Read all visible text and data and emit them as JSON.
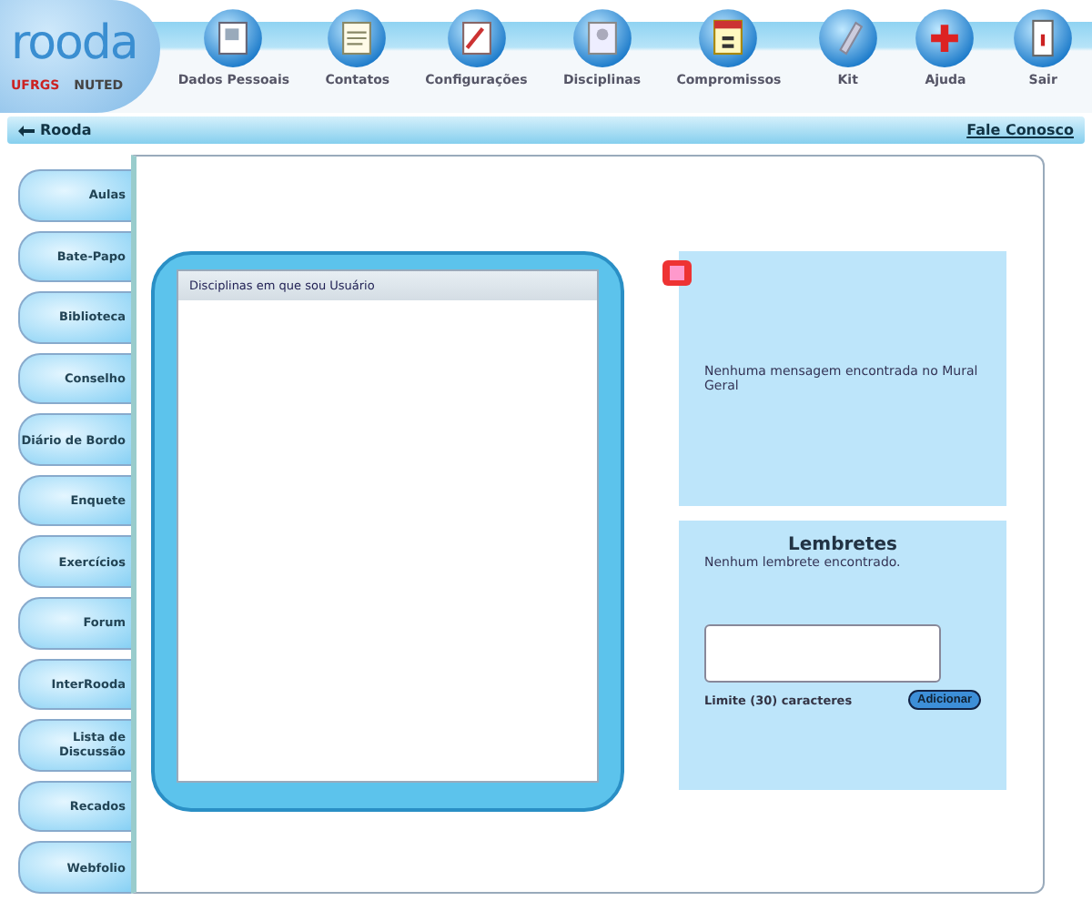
{
  "logo": {
    "title": "rooda",
    "partners": [
      "UFRGS",
      "NUTED"
    ]
  },
  "menu": [
    {
      "label": "Dados Pessoais"
    },
    {
      "label": "Contatos"
    },
    {
      "label": "Configurações"
    },
    {
      "label": "Disciplinas"
    },
    {
      "label": "Compromissos"
    },
    {
      "label": "Kit"
    },
    {
      "label": "Ajuda"
    },
    {
      "label": "Sair"
    }
  ],
  "breadcrumb": {
    "back": "Rooda",
    "contact": "Fale Conosco"
  },
  "sidebar": {
    "items": [
      {
        "label": "Aulas"
      },
      {
        "label": "Bate-Papo"
      },
      {
        "label": "Biblioteca"
      },
      {
        "label": "Conselho"
      },
      {
        "label": "Diário de Bordo"
      },
      {
        "label": "Enquete"
      },
      {
        "label": "Exercícios"
      },
      {
        "label": "Forum"
      },
      {
        "label": "InterRooda"
      },
      {
        "label": "Lista de Discussão"
      },
      {
        "label": "Recados"
      },
      {
        "label": "Webfolio"
      }
    ]
  },
  "disciplines": {
    "header": "Disciplinas em que sou Usuário"
  },
  "mural": {
    "message": "Nenhuma mensagem encontrada no Mural Geral"
  },
  "reminders": {
    "title": "Lembretes",
    "message": "Nenhum lembrete encontrado.",
    "limit": "Limite (30) caracteres",
    "button": "Adicionar"
  }
}
